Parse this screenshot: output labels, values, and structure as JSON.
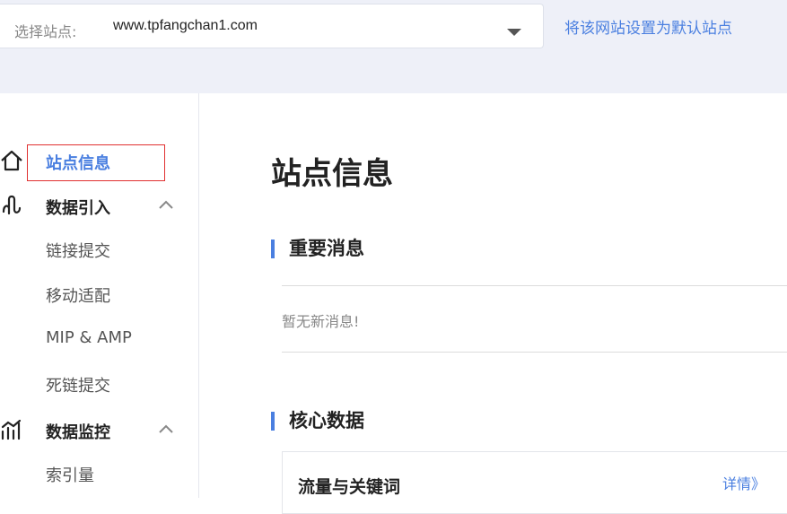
{
  "header": {
    "select_label": "选择站点:",
    "select_value": "www.tpfangchan1.com",
    "set_default_link": "将该网站设置为默认站点"
  },
  "sidebar": {
    "items": [
      {
        "label": "站点信息",
        "icon": "home-icon",
        "type": "item",
        "active": true
      },
      {
        "label": "数据引入",
        "icon": "data-import-icon",
        "type": "group",
        "expanded": true
      },
      {
        "label": "链接提交",
        "type": "subitem"
      },
      {
        "label": "移动适配",
        "type": "subitem"
      },
      {
        "label": "MIP & AMP",
        "type": "subitem"
      },
      {
        "label": "死链提交",
        "type": "subitem"
      },
      {
        "label": "数据监控",
        "icon": "chart-icon",
        "type": "group",
        "expanded": true
      },
      {
        "label": "索引量",
        "type": "subitem"
      }
    ]
  },
  "main": {
    "title": "站点信息",
    "sections": [
      {
        "title": "重要消息",
        "empty_text": "暂无新消息!"
      },
      {
        "title": "核心数据",
        "card": {
          "title": "流量与关键词",
          "link": "详情》"
        }
      }
    ]
  },
  "colors": {
    "accent": "#4a7fe0",
    "header_bg": "#eef0f8",
    "highlight_border": "#e03030"
  }
}
